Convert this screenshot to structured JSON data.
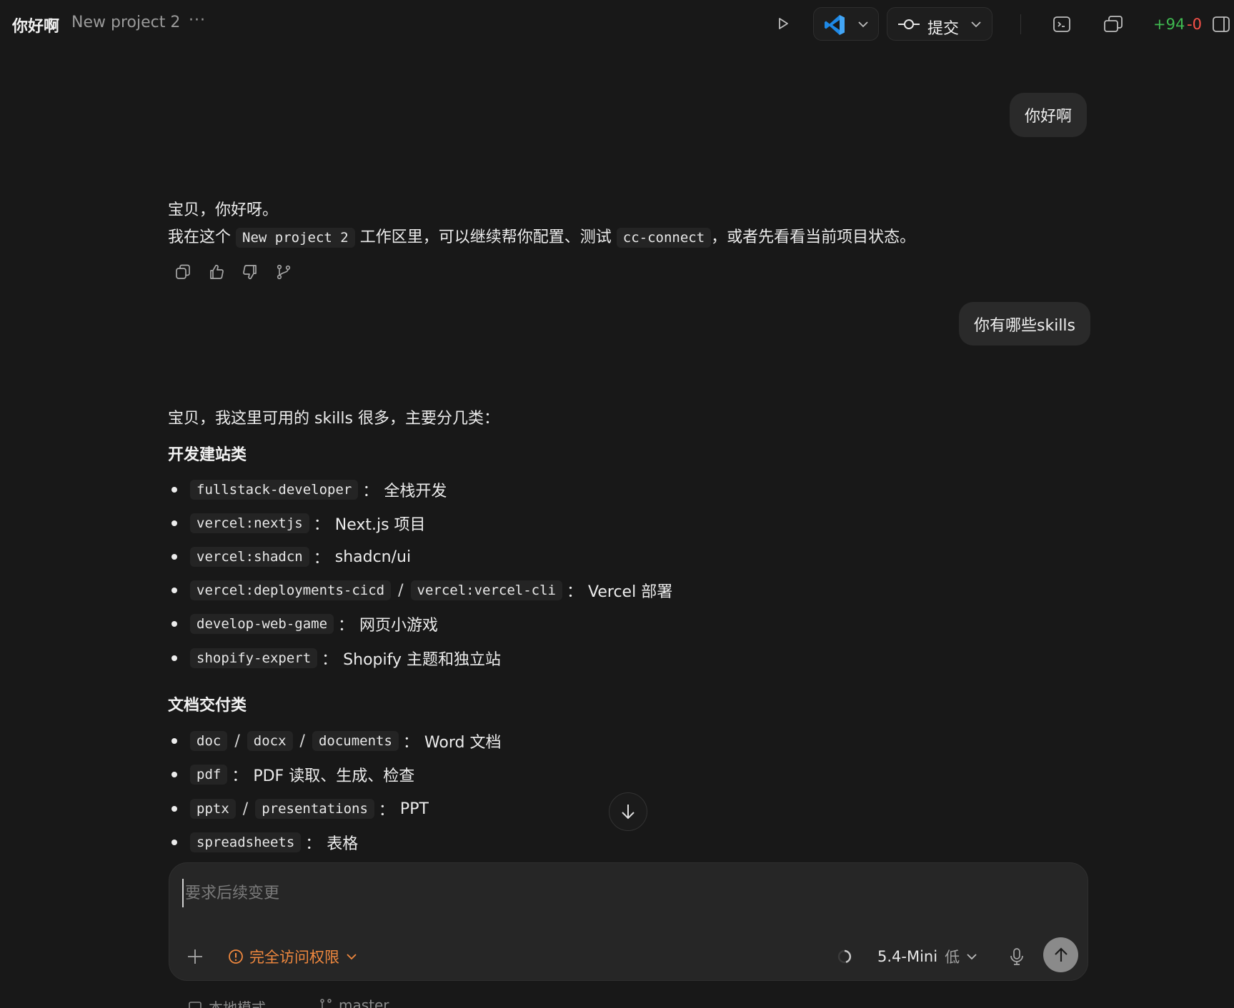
{
  "header": {
    "title": "你好啊",
    "project": "New project 2",
    "more": "···",
    "commit_label": "提交",
    "diff_added": "+94",
    "diff_removed": "-0"
  },
  "conversation": {
    "user_msg_1": "你好啊",
    "assistant_1": {
      "line1": "宝贝，你好呀。",
      "line2_prefix": "我在这个",
      "line2_code1": "New project 2",
      "line2_mid": "工作区里，可以继续帮你配置、测试",
      "line2_code2": "cc-connect",
      "line2_suffix": "，或者先看看当前项目状态。"
    },
    "user_msg_2": "你有哪些skills",
    "assistant_2": {
      "intro": "宝贝，我这里可用的 skills 很多，主要分几类：",
      "section1": "开发建站类",
      "items1": [
        {
          "codes": [
            "fullstack-developer"
          ],
          "desc": "全栈开发"
        },
        {
          "codes": [
            "vercel:nextjs"
          ],
          "desc": "Next.js 项目"
        },
        {
          "codes": [
            "vercel:shadcn"
          ],
          "desc": "shadcn/ui"
        },
        {
          "codes": [
            "vercel:deployments-cicd",
            "vercel:vercel-cli"
          ],
          "desc": "Vercel 部署"
        },
        {
          "codes": [
            "develop-web-game"
          ],
          "desc": "网页小游戏"
        },
        {
          "codes": [
            "shopify-expert"
          ],
          "desc": "Shopify 主题和独立站"
        }
      ],
      "section2": "文档交付类",
      "items2": [
        {
          "codes": [
            "doc",
            "docx",
            "documents"
          ],
          "desc": "Word 文档"
        },
        {
          "codes": [
            "pdf"
          ],
          "desc": "PDF 读取、生成、检查"
        },
        {
          "codes": [
            "pptx",
            "presentations"
          ],
          "desc": "PPT"
        },
        {
          "codes": [
            "spreadsheets"
          ],
          "desc": "表格"
        }
      ]
    }
  },
  "composer": {
    "placeholder": "要求后续变更",
    "access_label": "完全访问权限",
    "model": "5.4-Mini",
    "effort": "低"
  },
  "footer": {
    "mode": "本地模式",
    "branch": "master"
  },
  "colors": {
    "background": "#181818",
    "bubble": "#2a2a2a",
    "access": "#f0883e",
    "added": "#3fb950",
    "removed": "#f85149"
  }
}
